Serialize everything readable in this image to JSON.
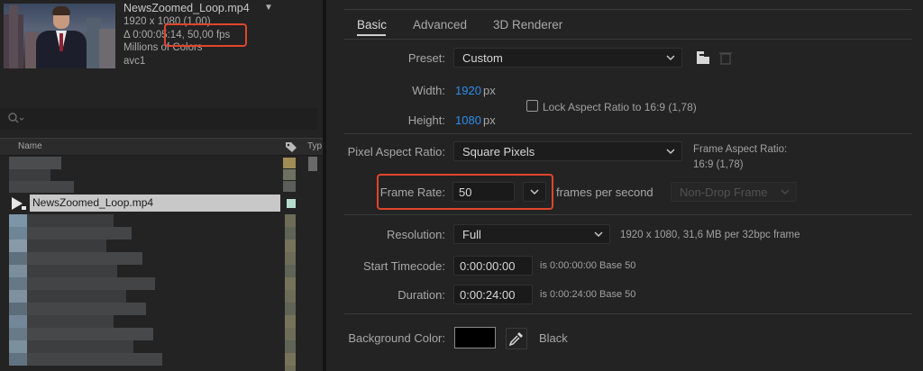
{
  "clip": {
    "name": "NewsZoomed_Loop.mp4",
    "resolution": "1920 x 1080 (1,00)",
    "duration_fps": "Δ 0:00:05:14, 50,00 fps",
    "color": "Millions of Colors",
    "codec": "avc1"
  },
  "project": {
    "column_name": "Name",
    "column_type": "Typ",
    "selected_item": "NewsZoomed_Loop.mp4"
  },
  "tabs": {
    "basic": "Basic",
    "advanced": "Advanced",
    "renderer": "3D Renderer"
  },
  "settings": {
    "preset_label": "Preset:",
    "preset_value": "Custom",
    "width_label": "Width:",
    "width_value": "1920",
    "height_label": "Height:",
    "height_value": "1080",
    "px_unit": "px",
    "lock_aspect_label": "Lock Aspect Ratio to 16:9 (1,78)",
    "lock_aspect_checked": false,
    "par_label": "Pixel Aspect Ratio:",
    "par_value": "Square Pixels",
    "frame_aspect_label": "Frame Aspect Ratio:",
    "frame_aspect_value": "16:9 (1,78)",
    "frame_rate_label": "Frame Rate:",
    "frame_rate_value": "50",
    "frame_rate_unit": "frames per second",
    "drop_frame_value": "Non-Drop Frame",
    "resolution_label": "Resolution:",
    "resolution_value": "Full",
    "resolution_info": "1920 x 1080, 31,6 MB per 32bpc frame",
    "start_tc_label": "Start Timecode:",
    "start_tc_value": "0:00:00:00",
    "start_tc_info": "is 0:00:00:00  Base 50",
    "duration_label": "Duration:",
    "duration_value": "0:00:24:00",
    "duration_info": "is 0:00:24:00  Base 50",
    "bg_color_label": "Background Color:",
    "bg_color_value": "#000000",
    "bg_color_name": "Black"
  },
  "colors": {
    "accent_blue": "#2d8ceb",
    "highlight_red": "#e0452c",
    "panel_bg": "#232323"
  }
}
